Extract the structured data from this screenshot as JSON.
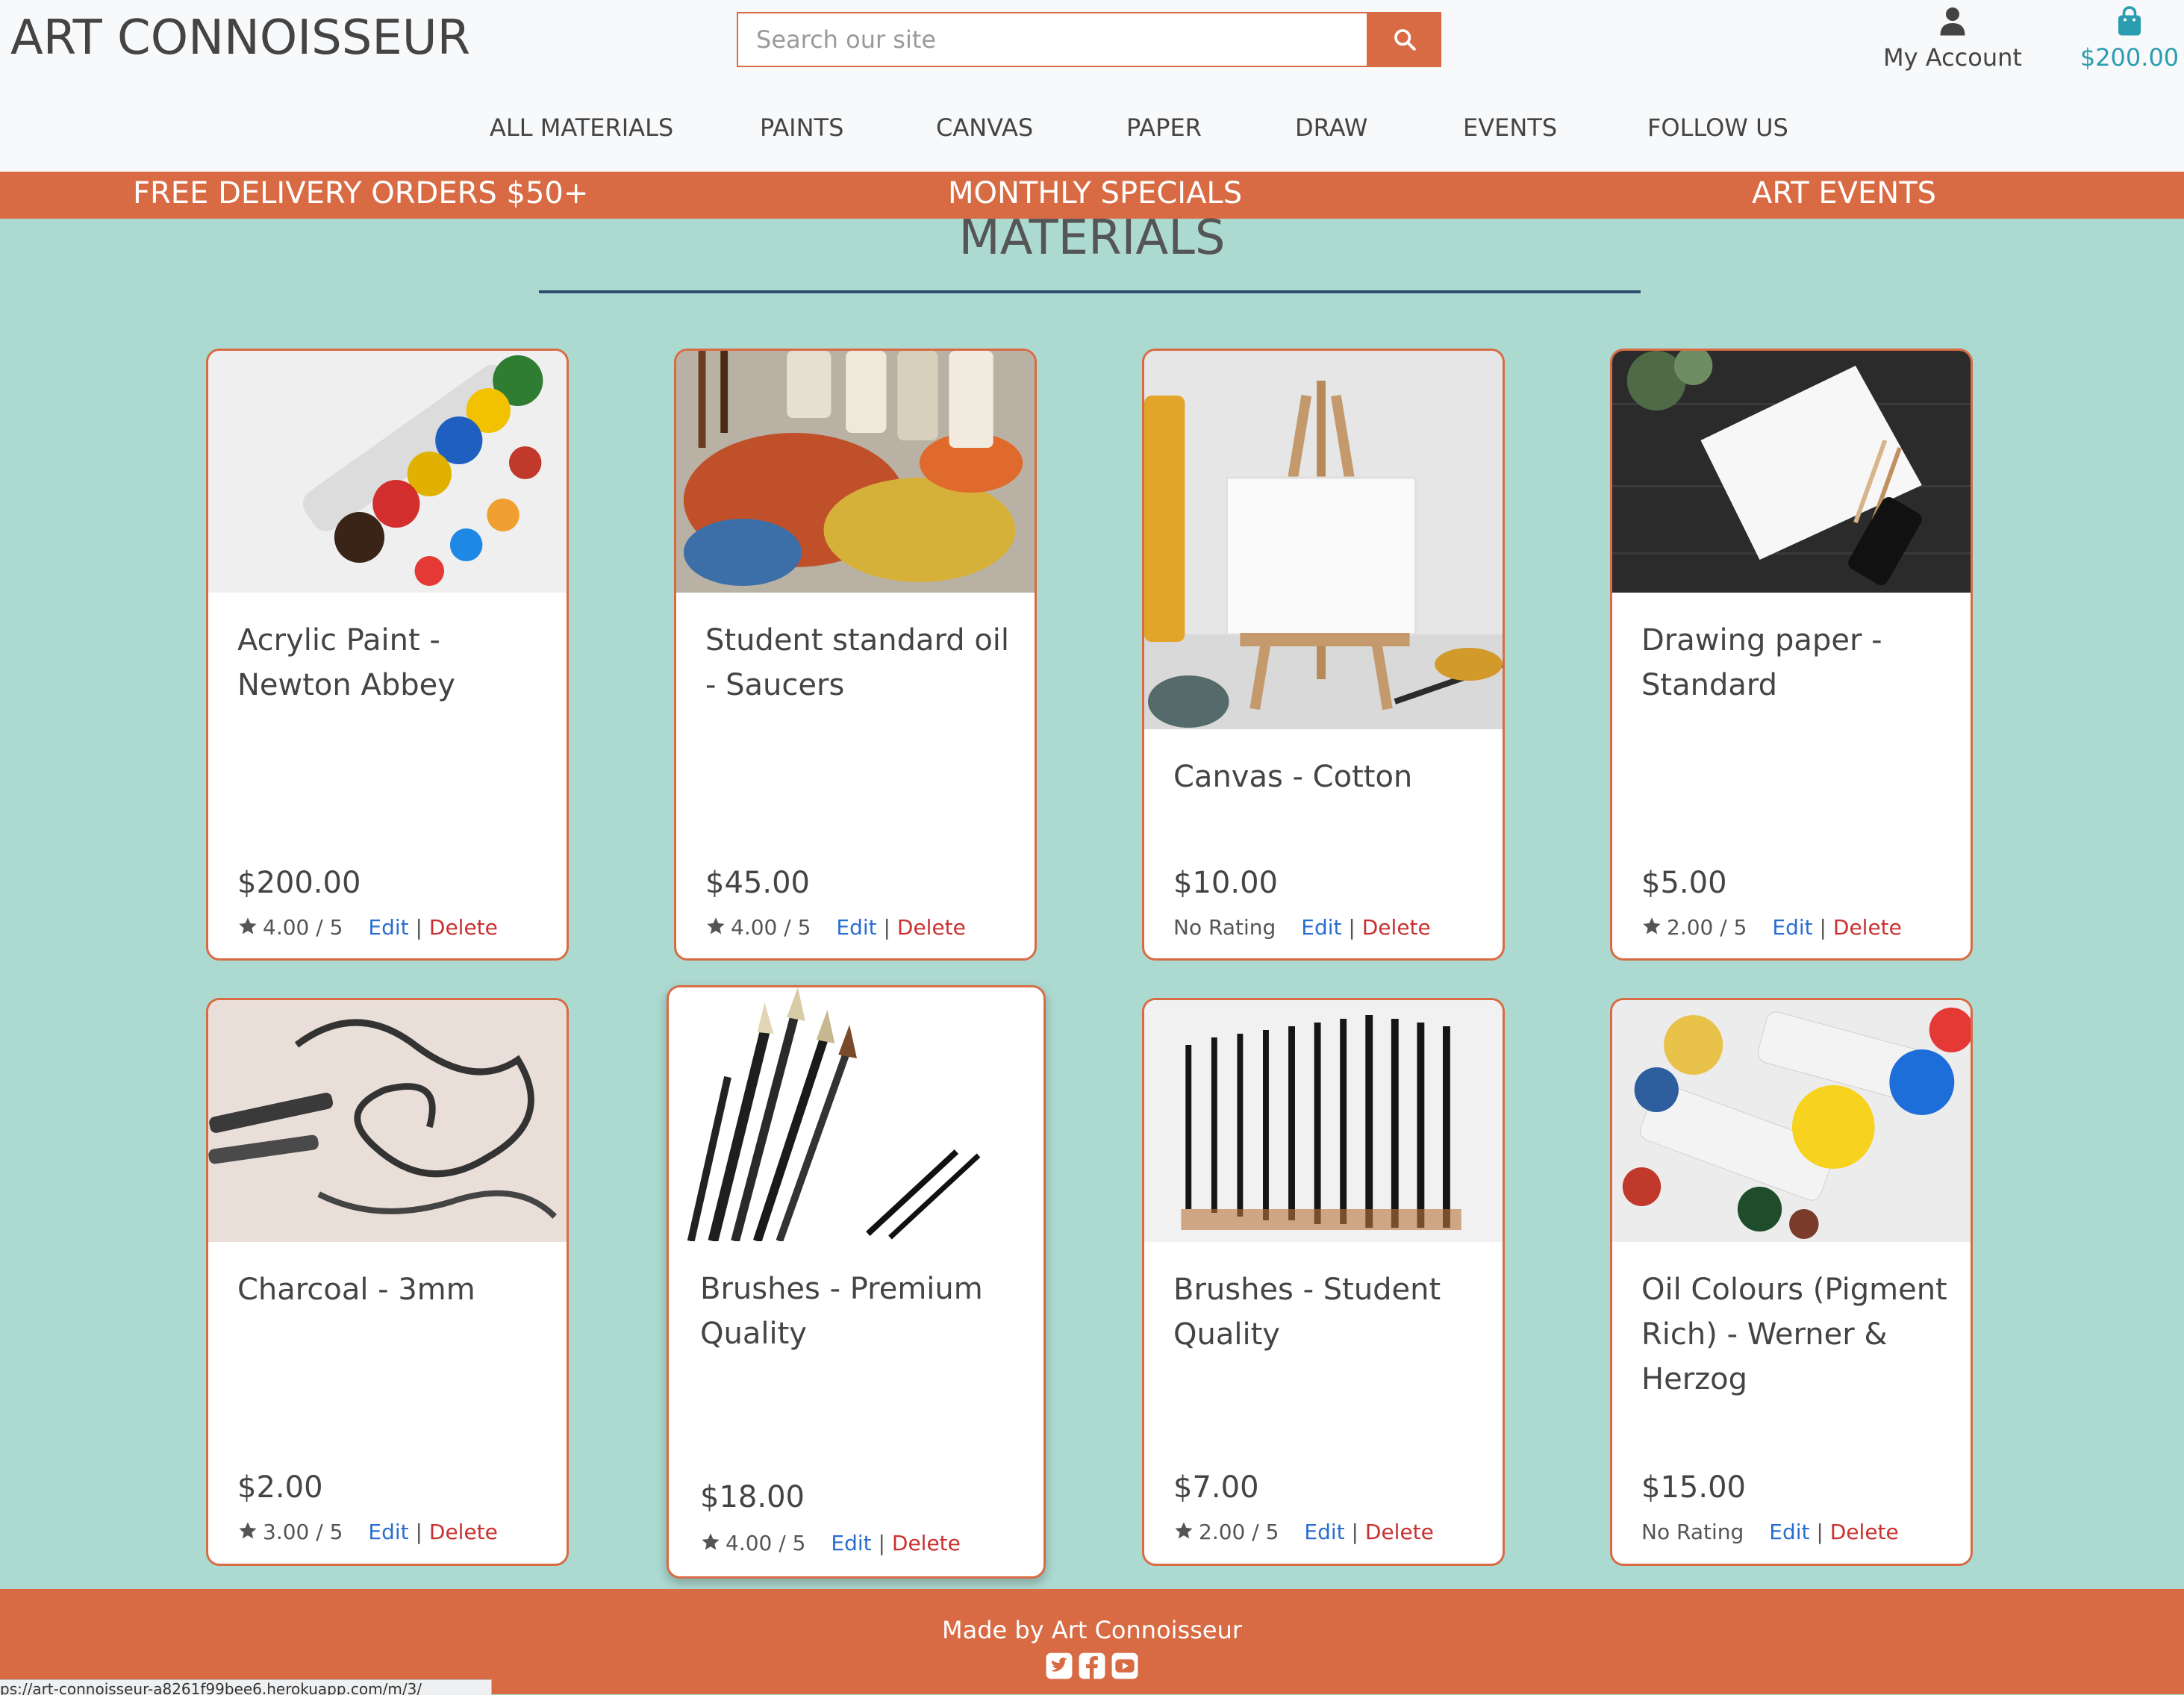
{
  "header": {
    "brand": "ART CONNOISSEUR",
    "search_placeholder": "Search our site",
    "account_label": "My Account",
    "cart_total": "$200.00"
  },
  "nav": [
    "ALL MATERIALS",
    "PAINTS",
    "CANVAS",
    "PAPER",
    "DRAW",
    "EVENTS",
    "FOLLOW US"
  ],
  "banner": [
    "FREE DELIVERY ORDERS $50+",
    "MONTHLY SPECIALS",
    "ART EVENTS"
  ],
  "page_title": "MATERIALS",
  "products": [
    {
      "name": "Acrylic Paint - Newton Abbey",
      "price": "$200.00",
      "rating": "4.00 / 5",
      "edit": "Edit",
      "sep": "|",
      "delete": "Delete"
    },
    {
      "name": "Student standard oil - Saucers",
      "price": "$45.00",
      "rating": "4.00 / 5",
      "edit": "Edit",
      "sep": "|",
      "delete": "Delete"
    },
    {
      "name": "Canvas - Cotton",
      "price": "$10.00",
      "rating": "No Rating",
      "edit": "Edit",
      "sep": "|",
      "delete": "Delete"
    },
    {
      "name": "Drawing paper - Standard",
      "price": "$5.00",
      "rating": "2.00 / 5",
      "edit": "Edit",
      "sep": "|",
      "delete": "Delete"
    },
    {
      "name": "Charcoal - 3mm",
      "price": "$2.00",
      "rating": "3.00 / 5",
      "edit": "Edit",
      "sep": "|",
      "delete": "Delete"
    },
    {
      "name": "Brushes - Premium Quality",
      "price": "$18.00",
      "rating": "4.00 / 5",
      "edit": "Edit",
      "sep": "|",
      "delete": "Delete"
    },
    {
      "name": "Brushes - Student Quality",
      "price": "$7.00",
      "rating": "2.00 / 5",
      "edit": "Edit",
      "sep": "|",
      "delete": "Delete"
    },
    {
      "name": "Oil Colours (Pigment Rich) - Werner & Herzog",
      "price": "$15.00",
      "rating": "No Rating",
      "edit": "Edit",
      "sep": "|",
      "delete": "Delete"
    }
  ],
  "footer": {
    "made_by": "Made by Art Connoisseur"
  },
  "status_url": "ps://art-connoisseur-a8261f99bee6.herokuapp.com/m/3/",
  "icons": [
    "search-icon",
    "user-icon",
    "shopping-bag-icon",
    "star-icon",
    "twitter-icon",
    "facebook-icon",
    "youtube-icon"
  ],
  "colors": {
    "accent": "#d86b44",
    "background": "#acd9d0",
    "cart": "#2a9db0",
    "edit_link": "#2a6ed0",
    "delete_link": "#c8312f"
  }
}
